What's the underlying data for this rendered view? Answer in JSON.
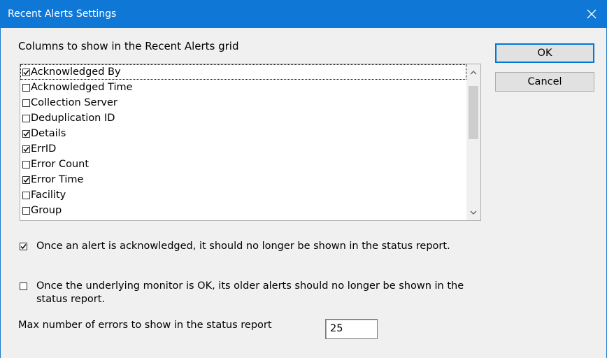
{
  "window": {
    "title": "Recent Alerts Settings",
    "close_icon": "close-icon",
    "title_bar_color": "#0f78d7"
  },
  "columns_section": {
    "label": "Columns to show in the Recent Alerts grid",
    "items": [
      {
        "label": "Acknowledged By",
        "checked": true,
        "focused": true
      },
      {
        "label": "Acknowledged Time",
        "checked": false
      },
      {
        "label": "Collection Server",
        "checked": false
      },
      {
        "label": "Deduplication ID",
        "checked": false
      },
      {
        "label": "Details",
        "checked": true
      },
      {
        "label": "ErrID",
        "checked": true
      },
      {
        "label": "Error Count",
        "checked": false
      },
      {
        "label": "Error Time",
        "checked": true
      },
      {
        "label": "Facility",
        "checked": false
      },
      {
        "label": "Group",
        "checked": false
      }
    ]
  },
  "buttons": {
    "ok_label": "OK",
    "cancel_label": "Cancel"
  },
  "options": {
    "hide_acknowledged": {
      "label": "Once an alert is acknowledged, it should no longer be shown in the status report.",
      "checked": true
    },
    "hide_when_monitor_ok": {
      "label": "Once the underlying monitor is OK, its older alerts should no longer be shown in the status report.",
      "checked": false
    }
  },
  "max_errors": {
    "label": "Max number of errors to show in the status report",
    "value": "25"
  }
}
